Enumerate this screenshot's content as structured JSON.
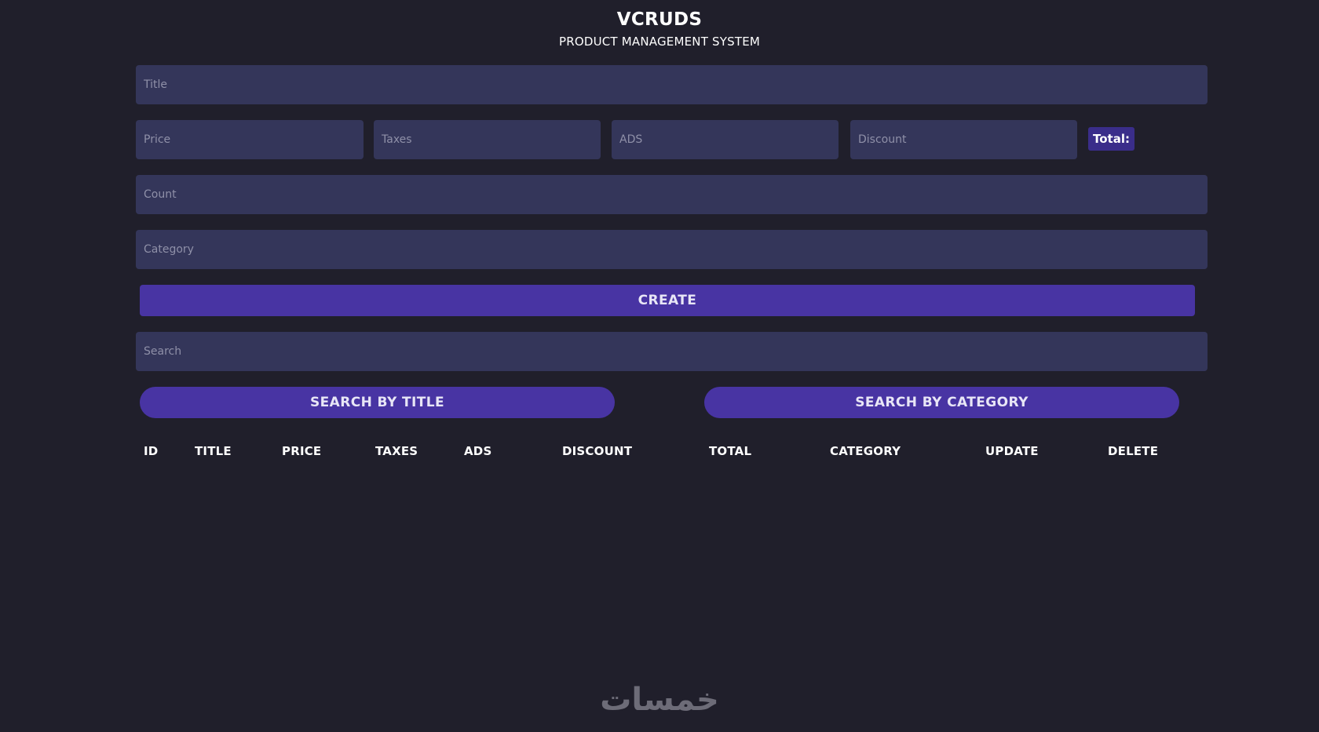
{
  "header": {
    "title": "VCRUDS",
    "subtitle": "PRODUCT MANAGEMENT SYSTEM"
  },
  "form": {
    "title_placeholder": "Title",
    "price_placeholder": "Price",
    "taxes_placeholder": "Taxes",
    "ads_placeholder": "ADS",
    "discount_placeholder": "Discount",
    "total_label": "Total:",
    "count_placeholder": "Count",
    "category_placeholder": "Category",
    "create_label": "CREATE"
  },
  "search": {
    "placeholder": "Search",
    "by_title_label": "SEARCH BY TITLE",
    "by_category_label": "SEARCH BY CATEGORY"
  },
  "table": {
    "columns": [
      "ID",
      "TITLE",
      "PRICE",
      "TAXES",
      "ADS",
      "DISCOUNT",
      "TOTAL",
      "CATEGORY",
      "UPDATE",
      "DELETE"
    ],
    "rows": []
  },
  "watermark": {
    "text": "خمسات"
  },
  "colors": {
    "background": "#201f2b",
    "input": "#34365a",
    "accent": "#4834a3",
    "total_badge": "#3a2d8a",
    "placeholder": "#8f90a8"
  }
}
